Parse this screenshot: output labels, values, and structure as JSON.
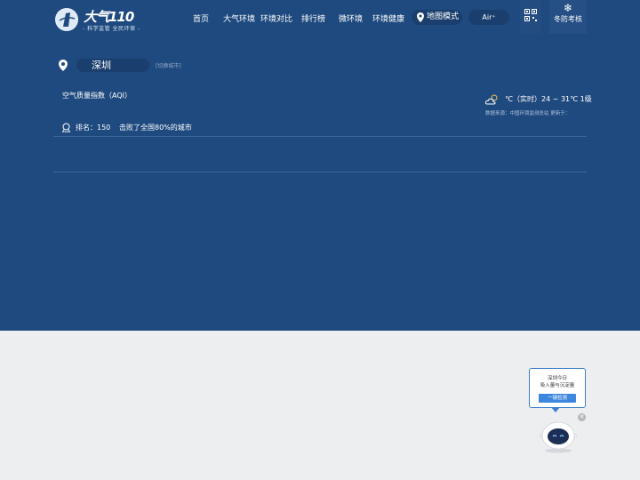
{
  "header": {
    "logo_text": "大气110",
    "logo_slogan": "- 科学监管 全民环保 -",
    "nav": [
      "首页",
      "大气环境",
      "环境对比",
      "排行榜",
      "微环境",
      "环境健康"
    ],
    "map_mode_label": "地图模式",
    "air_label": "Air⁺",
    "winter_label": "冬防考核"
  },
  "city": {
    "name": "深圳",
    "switch_label": "[切换城市]"
  },
  "aqi_label": "空气质量指数（AQI）",
  "weather": {
    "text": "℃（实时）24 ~ 31℃  1级",
    "source": "数据来源：中国环境监测总站      更新于："
  },
  "ranking": {
    "rank_text": "排名：150",
    "beat_text": "击败了全国80%的城市"
  },
  "helper": {
    "line1": "深圳今日",
    "line2": "吸入量与沉淀量",
    "button": "一键检测"
  },
  "icons": [
    "logo-mark-icon",
    "map-pin-icon",
    "qr-code-icon",
    "snowflake-icon",
    "location-icon",
    "partly-cloudy-icon",
    "rank-medal-icon",
    "close-icon",
    "robot-icon"
  ],
  "colors": {
    "hero_bg": "#1f4a7f",
    "pill_bg": "#1a3e6d",
    "lower_bg": "#edeef0",
    "accent_blue": "#3d86dd"
  }
}
